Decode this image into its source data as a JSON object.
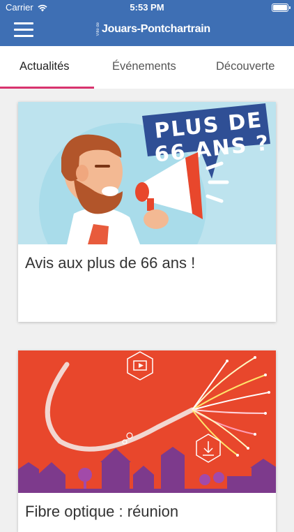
{
  "status_bar": {
    "carrier": "Carrier",
    "time": "5:53 PM"
  },
  "header": {
    "logo_prefix": "Ville de",
    "logo_name": "Jouars-Pontchartrain"
  },
  "tabs": [
    {
      "label": "Actualités",
      "active": true
    },
    {
      "label": "Événements",
      "active": false
    },
    {
      "label": "Découverte",
      "active": false
    }
  ],
  "articles": [
    {
      "title": "Avis aux plus de 66 ans !",
      "image_text_line1": "PLUS DE",
      "image_text_line2": "66 ANS ?"
    },
    {
      "title": "Fibre optique : réunion"
    }
  ],
  "colors": {
    "header": "#3e6fb4",
    "tab_accent": "#d8336e",
    "card1_bg": "#a9dcea",
    "card2_bg": "#e8472c"
  }
}
